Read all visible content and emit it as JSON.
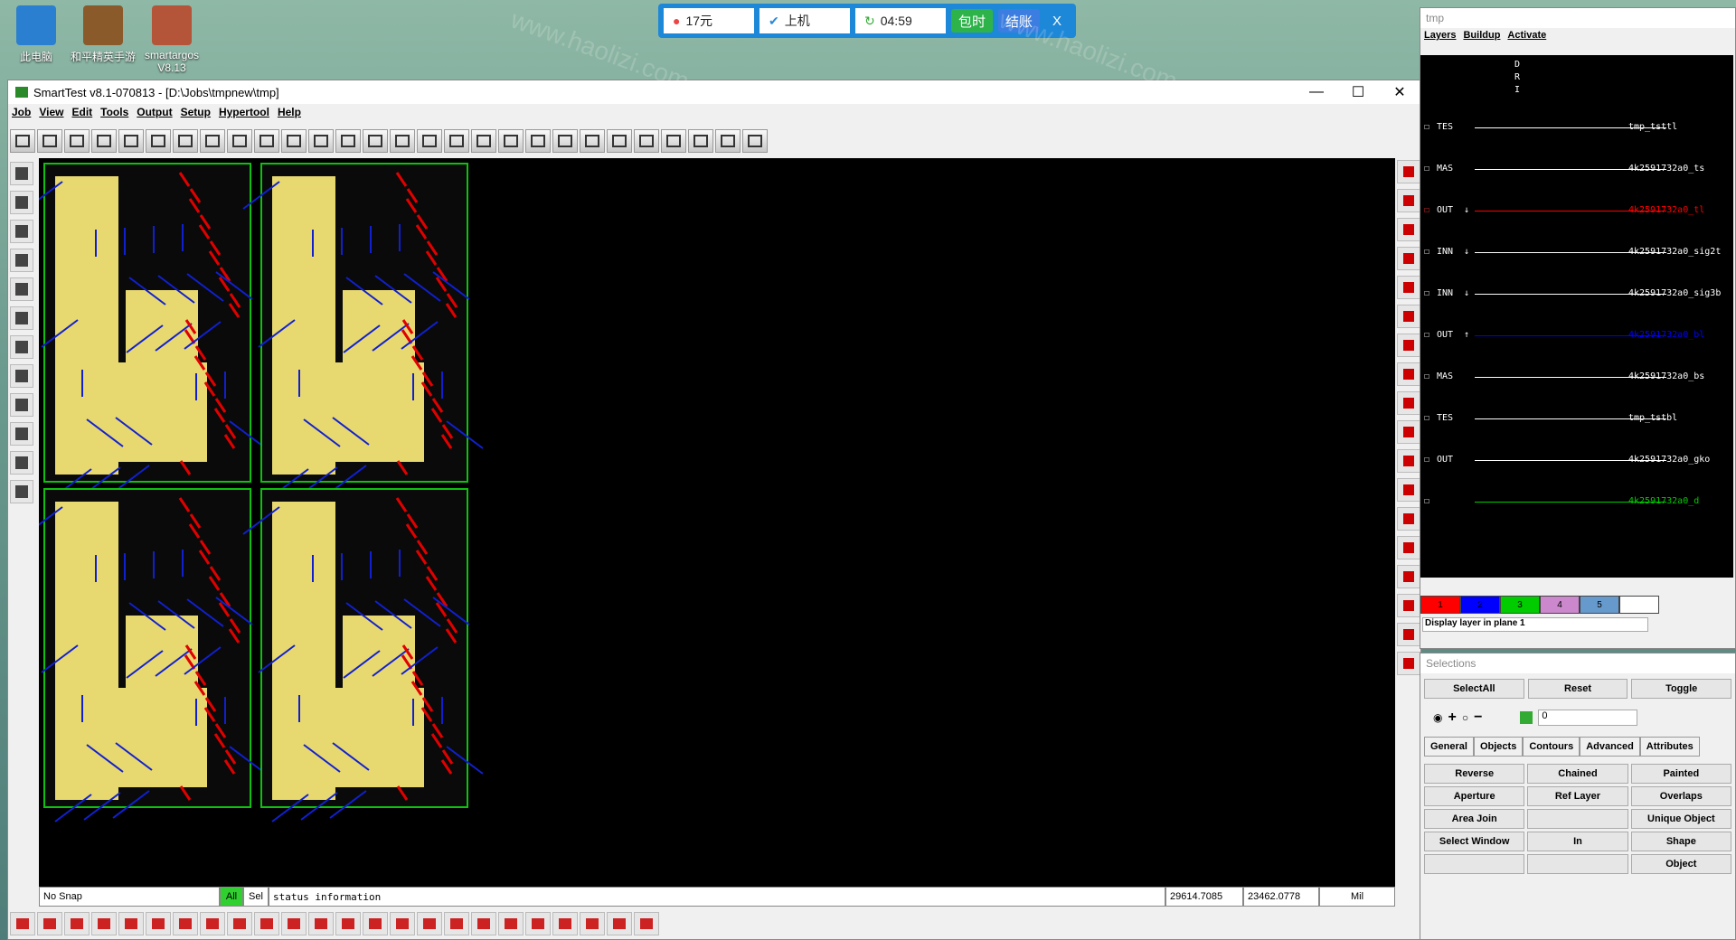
{
  "desktop": {
    "icons": [
      {
        "label": "此电脑"
      },
      {
        "label": "和平精英手游"
      },
      {
        "label": "smartargos V8.13"
      }
    ]
  },
  "topbar": {
    "cost": "17元",
    "status": "上机",
    "time": "04:59",
    "btn_package": "包时",
    "btn_checkout": "结账",
    "btn_close": "X"
  },
  "window": {
    "title": "SmartTest v8.1-070813 - [D:\\Jobs\\tmpnew\\tmp]",
    "min": "—",
    "max": "☐",
    "close": "✕"
  },
  "menu": [
    "Job",
    "View",
    "Edit",
    "Tools",
    "Output",
    "Setup",
    "Hypertool",
    "Help"
  ],
  "status": {
    "snap": "No Snap",
    "all": "All",
    "sel": "Sel",
    "info": "status information",
    "x": "29614.7085",
    "y": "23462.0778",
    "unit": "Mil"
  },
  "layers_panel": {
    "title": "tmp",
    "tabs": [
      "Layers",
      "Buildup",
      "Activate"
    ],
    "header": [
      "D",
      "R",
      "I"
    ],
    "rows": [
      {
        "kind": "TES",
        "name": "tmp_tsttl",
        "color": "#ffffff"
      },
      {
        "kind": "MAS",
        "name": "4k2591732a0_ts",
        "color": "#ffffff"
      },
      {
        "kind": "OUT",
        "name": "4k2591732a0_tl",
        "color": "#ff0000",
        "arrow": "↓"
      },
      {
        "kind": "INN",
        "name": "4k2591732a0_sig2t",
        "color": "#ffffff",
        "arrow": "↓"
      },
      {
        "kind": "INN",
        "name": "4k2591732a0_sig3b",
        "color": "#ffffff",
        "arrow": "↓"
      },
      {
        "kind": "OUT",
        "name": "4k2591732a0_bl",
        "color": "#0000ff",
        "arrow": "↑"
      },
      {
        "kind": "MAS",
        "name": "4k2591732a0_bs",
        "color": "#ffffff"
      },
      {
        "kind": "TES",
        "name": "tmp_tstbl",
        "color": "#ffffff"
      },
      {
        "kind": "OUT",
        "name": "4k2591732a0_gko",
        "color": "#ffffff"
      },
      {
        "kind": "",
        "name": "4k2591732a0_d",
        "color": "#00cc00"
      }
    ],
    "planes": [
      "1",
      "2",
      "3",
      "4",
      "5",
      ""
    ],
    "plane_colors": [
      "#ff0000",
      "#0000ff",
      "#00cc00",
      "#cc88cc",
      "#6699cc",
      "#ffffff"
    ],
    "footer": "Display layer in plane 1"
  },
  "selections_panel": {
    "title": "Selections",
    "buttons": [
      "SelectAll",
      "Reset",
      "Toggle"
    ],
    "value": "0",
    "tabs": [
      "General",
      "Objects",
      "Contours",
      "Advanced",
      "Attributes"
    ],
    "grid": [
      "Reverse",
      "Chained",
      "Painted",
      "Aperture",
      "Ref Layer",
      "Overlaps",
      "Area Join",
      "",
      "Unique Object",
      "Select Window",
      "In",
      "Shape",
      "",
      "",
      "Object"
    ]
  },
  "colors": {
    "pcb_fill": "#e8d870",
    "pcb_red": "#e00000",
    "pcb_blue": "#1020d0",
    "pcb_green": "#10c010"
  }
}
